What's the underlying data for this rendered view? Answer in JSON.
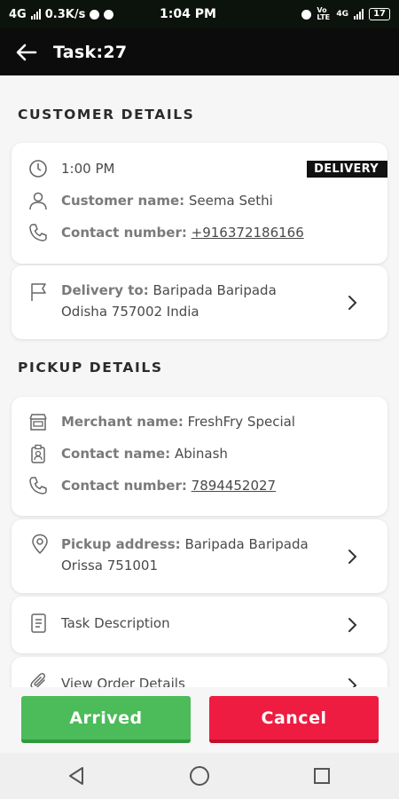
{
  "status_bar": {
    "network": "4G",
    "speed": "0.3K/s",
    "time": "1:04 PM",
    "volte": "Vo LTE",
    "net4g": "4G",
    "battery": "17"
  },
  "header": {
    "title": "Task:27",
    "back_icon": "arrow-left-icon"
  },
  "customer": {
    "section_title": "CUSTOMER DETAILS",
    "time": "1:00 PM",
    "badge": "DELIVERY",
    "name_label": "Customer name:",
    "name_value": "Seema Sethi",
    "contact_label": "Contact number:",
    "contact_value": "+916372186166",
    "delivery_label": "Delivery to:",
    "delivery_line1": "Baripada Baripada",
    "delivery_line2": "Odisha 757002 India"
  },
  "pickup": {
    "section_title": "PICKUP DETAILS",
    "merchant_label": "Merchant name:",
    "merchant_value": "FreshFry Special",
    "contact_name_label": "Contact name:",
    "contact_name_value": "Abinash",
    "contact_number_label": "Contact number:",
    "contact_number_value": "7894452027",
    "address_label": "Pickup address:",
    "address_line1": "Baripada Baripada",
    "address_line2": "Orissa 751001",
    "task_description": "Task Description",
    "view_order": "View Order Details"
  },
  "actions": {
    "arrived": "Arrived",
    "cancel": "Cancel"
  },
  "colors": {
    "arrived": "#4cbb5a",
    "cancel": "#ee1c40",
    "appbar": "#0c0c0c"
  }
}
